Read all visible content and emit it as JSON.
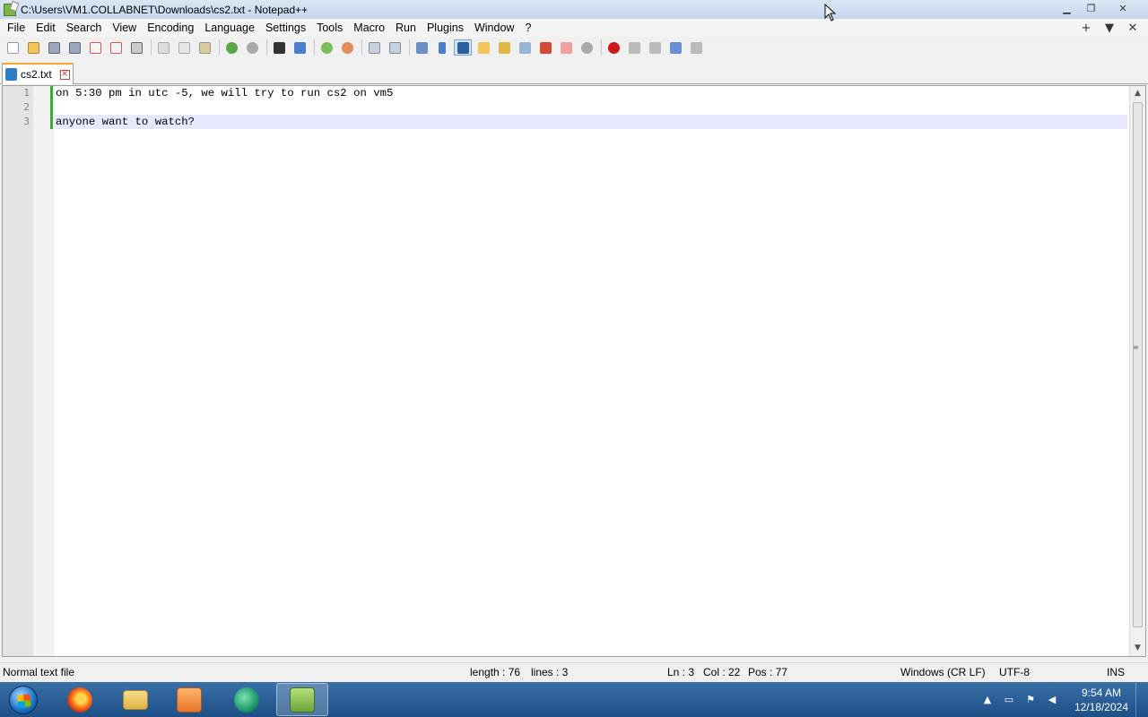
{
  "window": {
    "title": "C:\\Users\\VM1.COLLABNET\\Downloads\\cs2.txt - Notepad++"
  },
  "menu": {
    "items": [
      "File",
      "Edit",
      "Search",
      "View",
      "Encoding",
      "Language",
      "Settings",
      "Tools",
      "Macro",
      "Run",
      "Plugins",
      "Window",
      "?"
    ],
    "right": [
      "+",
      "▼",
      "✕"
    ]
  },
  "tabs": [
    {
      "label": "cs2.txt"
    }
  ],
  "editor": {
    "line_numbers": [
      "1",
      "2",
      "3"
    ],
    "lines": [
      "on 5:30 pm in utc -5, we will try to run cs2 on vm5",
      "",
      "anyone want to watch?"
    ],
    "current_line": 3
  },
  "status": {
    "file_type": "Normal text file",
    "length": "length : 76",
    "lines": "lines : 3",
    "ln": "Ln : 3",
    "col": "Col : 22",
    "pos": "Pos : 77",
    "eol": "Windows (CR LF)",
    "encoding": "UTF-8",
    "mode": "INS"
  },
  "taskbar": {
    "apps": [
      "firefox-icon",
      "file-explorer-icon",
      "media-player-icon",
      "browser-icon",
      "notepadpp-icon"
    ],
    "active_app": "notepadpp-icon",
    "time": "9:54 AM",
    "date": "12/18/2024"
  },
  "colors": {
    "tab_accent": "#f7a630",
    "change_bar": "#3caa3c",
    "current_line_bg": "#e8e8ff"
  }
}
